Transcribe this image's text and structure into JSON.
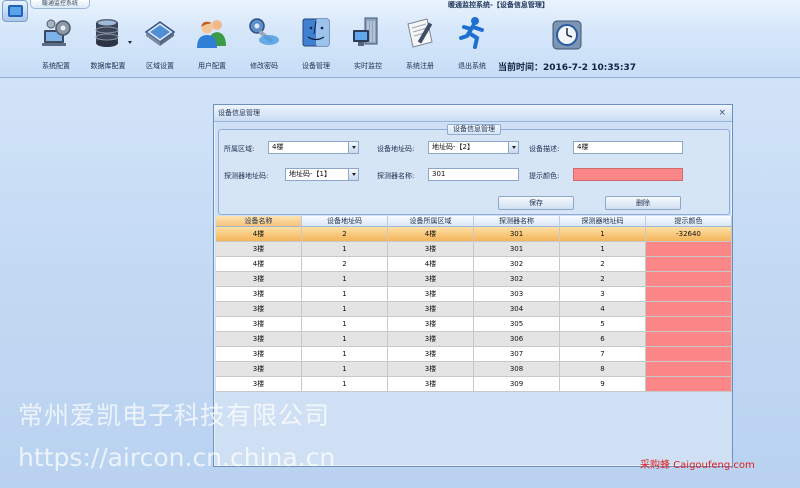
{
  "app": {
    "tab_label": "暖通监控系统",
    "window_title": "暖通监控系统-【设备信息管理】"
  },
  "toolbar": {
    "items": [
      {
        "label": "系统配置",
        "icon": "gears-computer-icon"
      },
      {
        "label": "数据库配置",
        "icon": "database-icon"
      },
      {
        "label": "区域设置",
        "icon": "region-monitor-icon"
      },
      {
        "label": "用户配置",
        "icon": "users-icon"
      },
      {
        "label": "修改密码",
        "icon": "key-icon"
      },
      {
        "label": "设备管理",
        "icon": "finder-device-icon"
      },
      {
        "label": "实时监控",
        "icon": "building-monitor-icon"
      },
      {
        "label": "系统注册",
        "icon": "register-pen-icon"
      },
      {
        "label": "退出系统",
        "icon": "running-man-icon"
      }
    ],
    "current_time_label": "当前时间：",
    "current_time_value": "2016-7-2 10:35:37"
  },
  "dialog": {
    "title": "设备信息管理",
    "close_glyph": "×",
    "group_caption": "设备信息管理",
    "fields": {
      "area_label": "所属区域:",
      "area_value": "4楼",
      "address_label": "设备地址码:",
      "address_value": "地址码-【2】",
      "desc_label": "设备描述:",
      "desc_value": "4楼",
      "detector_addr_label": "探测器地址码:",
      "detector_addr_value": "地址码-【1】",
      "detector_name_label": "探测器名称:",
      "detector_name_value": "301",
      "color_label": "提示颜色:",
      "color_value": "#fa8688"
    },
    "buttons": {
      "save": "保存",
      "delete": "删除"
    },
    "grid": {
      "headers": [
        "设备名称",
        "设备地址码",
        "设备所属区域",
        "探测器名称",
        "探测器地址码",
        "提示颜色"
      ],
      "rows": [
        [
          "4楼",
          "2",
          "4楼",
          "301",
          "1",
          "-32640"
        ],
        [
          "3楼",
          "1",
          "3楼",
          "301",
          "1",
          ""
        ],
        [
          "4楼",
          "2",
          "4楼",
          "302",
          "2",
          ""
        ],
        [
          "3楼",
          "1",
          "3楼",
          "302",
          "2",
          ""
        ],
        [
          "3楼",
          "1",
          "3楼",
          "303",
          "3",
          ""
        ],
        [
          "3楼",
          "1",
          "3楼",
          "304",
          "4",
          ""
        ],
        [
          "3楼",
          "1",
          "3楼",
          "305",
          "5",
          ""
        ],
        [
          "3楼",
          "1",
          "3楼",
          "306",
          "6",
          ""
        ],
        [
          "3楼",
          "1",
          "3楼",
          "307",
          "7",
          ""
        ],
        [
          "3楼",
          "1",
          "3楼",
          "308",
          "8",
          ""
        ],
        [
          "3楼",
          "1",
          "3楼",
          "309",
          "9",
          ""
        ]
      ],
      "selected_row": 0,
      "row_color": "#fa8688"
    }
  },
  "watermarks": {
    "company": "常州爱凯电子科技有限公司",
    "url": "https://aircon.cn.china.cn",
    "corner": "采购蜂 Caigoufeng.com"
  }
}
